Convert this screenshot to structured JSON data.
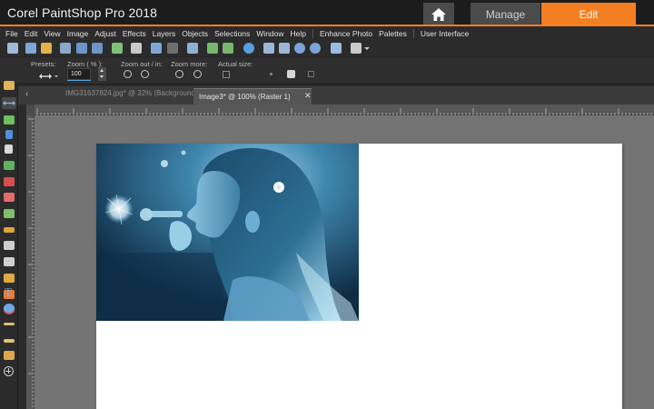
{
  "app": {
    "title": "Corel PaintShop Pro 2018",
    "home_icon": "home-icon",
    "tabs": [
      {
        "label": "Manage",
        "active": false
      },
      {
        "label": "Edit",
        "active": true
      }
    ],
    "accent_color": "#f47f22"
  },
  "menu": {
    "items": [
      "File",
      "Edit",
      "View",
      "Image",
      "Adjust",
      "Effects",
      "Layers",
      "Objects",
      "Selections",
      "Window",
      "Help"
    ],
    "items_right": [
      "Enhance Photo",
      "Palettes",
      "User Interface"
    ]
  },
  "tool_options": {
    "presets_label": "Presets:",
    "zoom_label": "Zoom ( % ):",
    "zoom_value": "100",
    "zoom_out_in_label": "Zoom out / in:",
    "zoom_more_label": "Zoom more:",
    "actual_size_label": "Actual size:"
  },
  "documents": {
    "tabs": [
      {
        "label": "IMG31637824.jpg* @ 32% (Background)",
        "active": false
      },
      {
        "label": "Image3* @ 100% (Raster 1)",
        "active": true
      }
    ]
  },
  "canvas": {
    "background": "#ffffff",
    "photo_description_icon": "photo-layer"
  }
}
